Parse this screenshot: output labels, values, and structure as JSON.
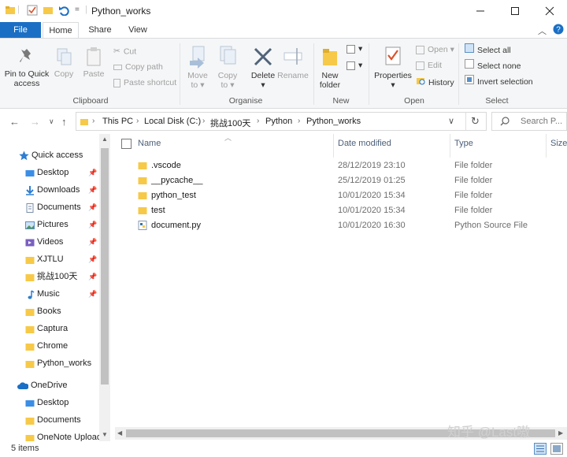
{
  "window": {
    "title": "Python_works",
    "qat_separator": "="
  },
  "tabs": [
    {
      "label": "File"
    },
    {
      "label": "Home"
    },
    {
      "label": "Share"
    },
    {
      "label": "View"
    }
  ],
  "ribbon": {
    "clipboard": {
      "pin_label_1": "Pin to Quick",
      "pin_label_2": "access",
      "copy_label": "Copy",
      "paste_label": "Paste",
      "cut_label": "Cut",
      "copy_path_label": "Copy path",
      "paste_shortcut_label": "Paste shortcut",
      "group_label": "Clipboard"
    },
    "organise": {
      "move_label_1": "Move",
      "move_label_2": "to",
      "copy_label_1": "Copy",
      "copy_label_2": "to",
      "delete_label": "Delete",
      "rename_label": "Rename",
      "group_label": "Organise"
    },
    "new": {
      "new_folder_label_1": "New",
      "new_folder_label_2": "folder",
      "group_label": "New"
    },
    "open": {
      "properties_label": "Properties",
      "open_label": "Open",
      "edit_label": "Edit",
      "history_label": "History",
      "group_label": "Open"
    },
    "select": {
      "select_all_label": "Select all",
      "select_none_label": "Select none",
      "invert_selection_label": "Invert selection",
      "group_label": "Select"
    }
  },
  "address": {
    "crumbs": [
      "This PC",
      "Local Disk (C:)",
      "挑战100天",
      "Python",
      "Python_works"
    ],
    "search_placeholder": "Search P..."
  },
  "sidebar": {
    "quick_access_label": "Quick access",
    "items": [
      {
        "label": "Desktop",
        "pinned": true
      },
      {
        "label": "Downloads",
        "pinned": true
      },
      {
        "label": "Documents",
        "pinned": true
      },
      {
        "label": "Pictures",
        "pinned": true
      },
      {
        "label": "Videos",
        "pinned": true
      },
      {
        "label": "XJTLU",
        "pinned": true
      },
      {
        "label": "挑战100天",
        "pinned": true
      },
      {
        "label": "Music",
        "pinned": true
      },
      {
        "label": "Books",
        "pinned": false
      },
      {
        "label": "Captura",
        "pinned": false
      },
      {
        "label": "Chrome",
        "pinned": false
      },
      {
        "label": "Python_works",
        "pinned": false
      }
    ],
    "onedrive_label": "OneDrive",
    "onedrive_items": [
      {
        "label": "Desktop"
      },
      {
        "label": "Documents"
      },
      {
        "label": "OneNote Uploads"
      }
    ]
  },
  "columns": {
    "name": "Name",
    "date_modified": "Date modified",
    "type": "Type",
    "size": "Size"
  },
  "files": [
    {
      "name": ".vscode",
      "date": "28/12/2019 23:10",
      "type": "File folder",
      "icon": "folder"
    },
    {
      "name": "__pycache__",
      "date": "25/12/2019 01:25",
      "type": "File folder",
      "icon": "folder"
    },
    {
      "name": "python_test",
      "date": "10/01/2020 15:34",
      "type": "File folder",
      "icon": "folder"
    },
    {
      "name": "test",
      "date": "10/01/2020 15:34",
      "type": "File folder",
      "icon": "folder"
    },
    {
      "name": "document.py",
      "date": "10/01/2020 16:30",
      "type": "Python Source File",
      "icon": "python-file"
    }
  ],
  "status": {
    "items_count": "5 items"
  },
  "watermark": "知乎 @Last嗷",
  "colors": {
    "accent": "#1a6fc4",
    "folder": "#f7c948",
    "header_text": "#4c607a"
  }
}
